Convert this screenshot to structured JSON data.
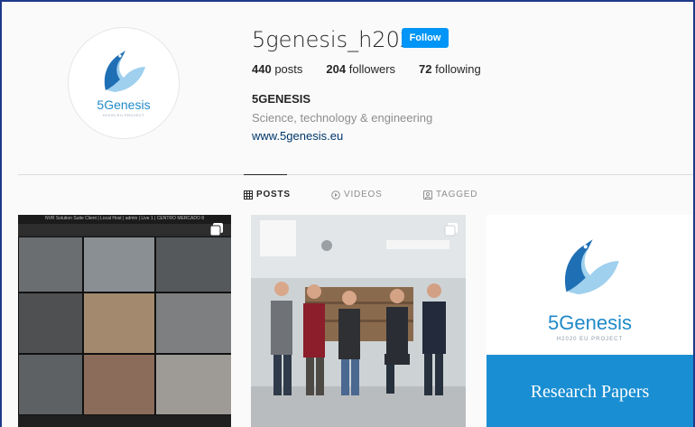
{
  "profile": {
    "username": "5genesis_h2020",
    "follow_label": "Follow",
    "stats": {
      "posts_count": "440",
      "posts_label": "posts",
      "followers_count": "204",
      "followers_label": "followers",
      "following_count": "72",
      "following_label": "following"
    },
    "full_name": "5GENESIS",
    "category": "Science, technology & engineering",
    "website": "www.5genesis.eu",
    "logo_text": "5Genesis",
    "logo_tagline": "H2020 EU PROJECT"
  },
  "tabs": [
    {
      "label": "POSTS",
      "icon": "grid-icon",
      "active": true
    },
    {
      "label": "VIDEOS",
      "icon": "play-icon",
      "active": false
    },
    {
      "label": "TAGGED",
      "icon": "tag-icon",
      "active": false
    }
  ],
  "posts": [
    {
      "kind": "cctv-screenshot",
      "caption_bar": "NVR Solution Suite Client | Local Host | admin | Live 1 | CENTRO MERCADO 8"
    },
    {
      "kind": "team-photo"
    },
    {
      "kind": "research-papers",
      "logo_text": "5Genesis",
      "tagline": "H2020 EU PROJECT",
      "banner": "Research Papers"
    }
  ],
  "colors": {
    "follow_button": "#0095f6",
    "brand_blue": "#1f8ac8",
    "banner_blue": "#1a8ed2",
    "link": "#00376b"
  }
}
